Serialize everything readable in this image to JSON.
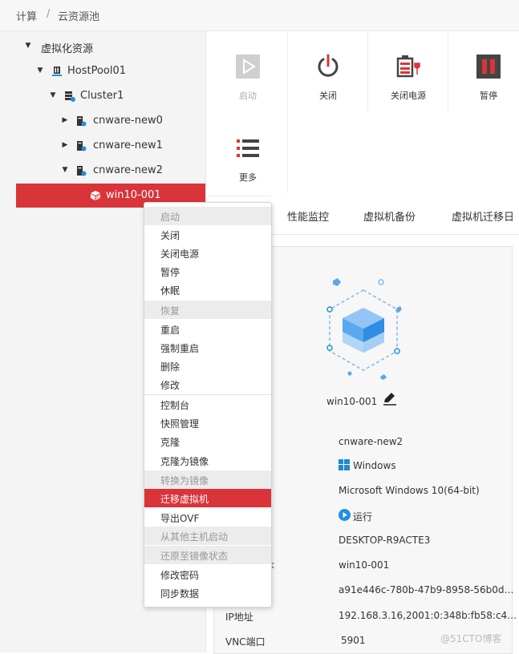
{
  "breadcrumb": {
    "first": "计算",
    "sep": "/",
    "second": "云资源池"
  },
  "tree": {
    "root": "虚拟化资源",
    "pool": "HostPool01",
    "cluster": "Cluster1",
    "hosts": [
      "cnware-new0",
      "cnware-new1",
      "cnware-new2"
    ],
    "vm": "win10-001"
  },
  "toolbar": {
    "start": "启动",
    "shutdown": "关闭",
    "power_off": "关闭电源",
    "pause": "暂停",
    "more": "更多"
  },
  "tabs": [
    "性能监控",
    "虚拟机备份",
    "虚拟机迁移日"
  ],
  "context_menu": [
    {
      "label": "启动",
      "disabled": true
    },
    {
      "label": "关闭"
    },
    {
      "label": "关闭电源"
    },
    {
      "label": "暂停"
    },
    {
      "label": "休眠"
    },
    {
      "label": "恢复",
      "disabled": true
    },
    {
      "label": "重启"
    },
    {
      "label": "强制重启"
    },
    {
      "label": "删除"
    },
    {
      "label": "修改"
    },
    {
      "label": "控制台"
    },
    {
      "label": "快照管理"
    },
    {
      "label": "克隆"
    },
    {
      "label": "克隆为镜像"
    },
    {
      "label": "转换为镜像",
      "disabled": true
    },
    {
      "label": "迁移虚拟机",
      "active": true
    },
    {
      "label": "导出OVF"
    },
    {
      "label": "从其他主机启动",
      "disabled": true
    },
    {
      "label": "还原至镜像状态",
      "disabled": true
    },
    {
      "label": "修改密码"
    },
    {
      "label": "同步数据"
    }
  ],
  "detail": {
    "vm_name": "win10-001",
    "host": "cnware-new2",
    "os_type": "Windows",
    "os_version": "Microsoft Windows 10(64-bit)",
    "status": "运行",
    "computer_name": "DESKTOP-R9ACTE3",
    "hidden_label_tail": "k",
    "display_name": "win10-001",
    "uuid": "a91e446c-780b-47b9-8958-56b0d…",
    "ip_label": "IP地址",
    "ip_value": "192.168.3.16,2001:0:348b:fb58:c4…",
    "vnc_label": "VNC端口",
    "vnc_value": "5901"
  },
  "watermark": "@51CTO博客",
  "colors": {
    "accent": "#d9343a",
    "play_disabled": "#c8c8c8",
    "status_blue": "#1f8fe0",
    "windows_blue": "#1e8ad6"
  }
}
